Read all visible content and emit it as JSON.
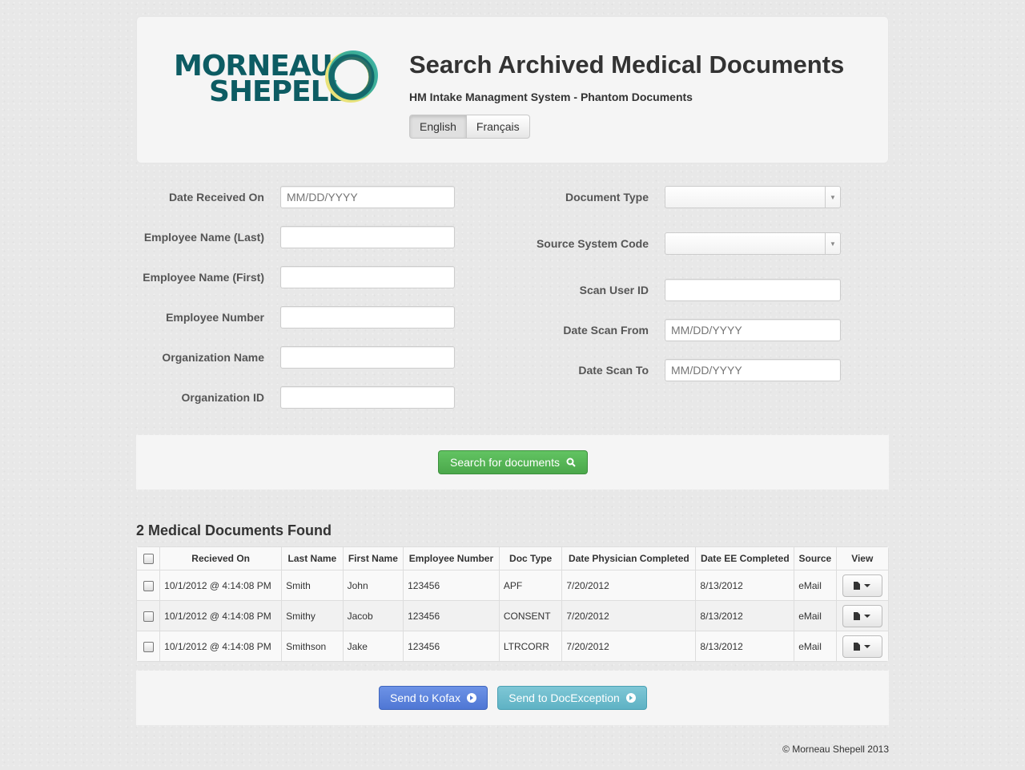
{
  "header": {
    "logo_line1": "MORNEAU",
    "logo_line2": "SHEPELL",
    "title": "Search Archived Medical Documents",
    "subtitle": "HM Intake Managment System - Phantom Documents",
    "languages": [
      "English",
      "Français"
    ],
    "active_language": "English"
  },
  "form": {
    "left": [
      {
        "label": "Date Received On",
        "placeholder": "MM/DD/YYYY"
      },
      {
        "label": "Employee Name (Last)",
        "placeholder": ""
      },
      {
        "label": "Employee Name (First)",
        "placeholder": ""
      },
      {
        "label": "Employee Number",
        "placeholder": ""
      },
      {
        "label": "Organization Name",
        "placeholder": ""
      },
      {
        "label": "Organization ID",
        "placeholder": ""
      }
    ],
    "right": [
      {
        "label": "Document Type",
        "type": "select",
        "value": ""
      },
      {
        "label": "Source System Code",
        "type": "select",
        "value": ""
      },
      {
        "label": "Scan User ID",
        "type": "input",
        "placeholder": ""
      },
      {
        "label": "Date Scan From",
        "type": "input",
        "placeholder": "MM/DD/YYYY"
      },
      {
        "label": "Date Scan To",
        "type": "input",
        "placeholder": "MM/DD/YYYY"
      }
    ]
  },
  "search_button": "Search for documents",
  "results": {
    "count_label": "2 Medical Documents Found",
    "columns": [
      "Recieved On",
      "Last Name",
      "First Name",
      "Employee Number",
      "Doc Type",
      "Date Physician Completed",
      "Date EE Completed",
      "Source",
      "View"
    ],
    "rows": [
      [
        "10/1/2012 @ 4:14:08 PM",
        "Smith",
        "John",
        "123456",
        "APF",
        "7/20/2012",
        "8/13/2012",
        "eMail"
      ],
      [
        "10/1/2012 @ 4:14:08 PM",
        "Smithy",
        "Jacob",
        "123456",
        "CONSENT",
        "7/20/2012",
        "8/13/2012",
        "eMail"
      ],
      [
        "10/1/2012 @ 4:14:08 PM",
        "Smithson",
        "Jake",
        "123456",
        "LTRCORR",
        "7/20/2012",
        "8/13/2012",
        "eMail"
      ]
    ]
  },
  "actions": {
    "kofax": "Send to Kofax",
    "docexception": "Send to DocException"
  },
  "footer": "© Morneau Shepell 2013",
  "colors": {
    "brand": "#0d5c63",
    "search": "#5bb75b",
    "kofax": "#5a82dc",
    "docexception": "#6cbccc"
  }
}
